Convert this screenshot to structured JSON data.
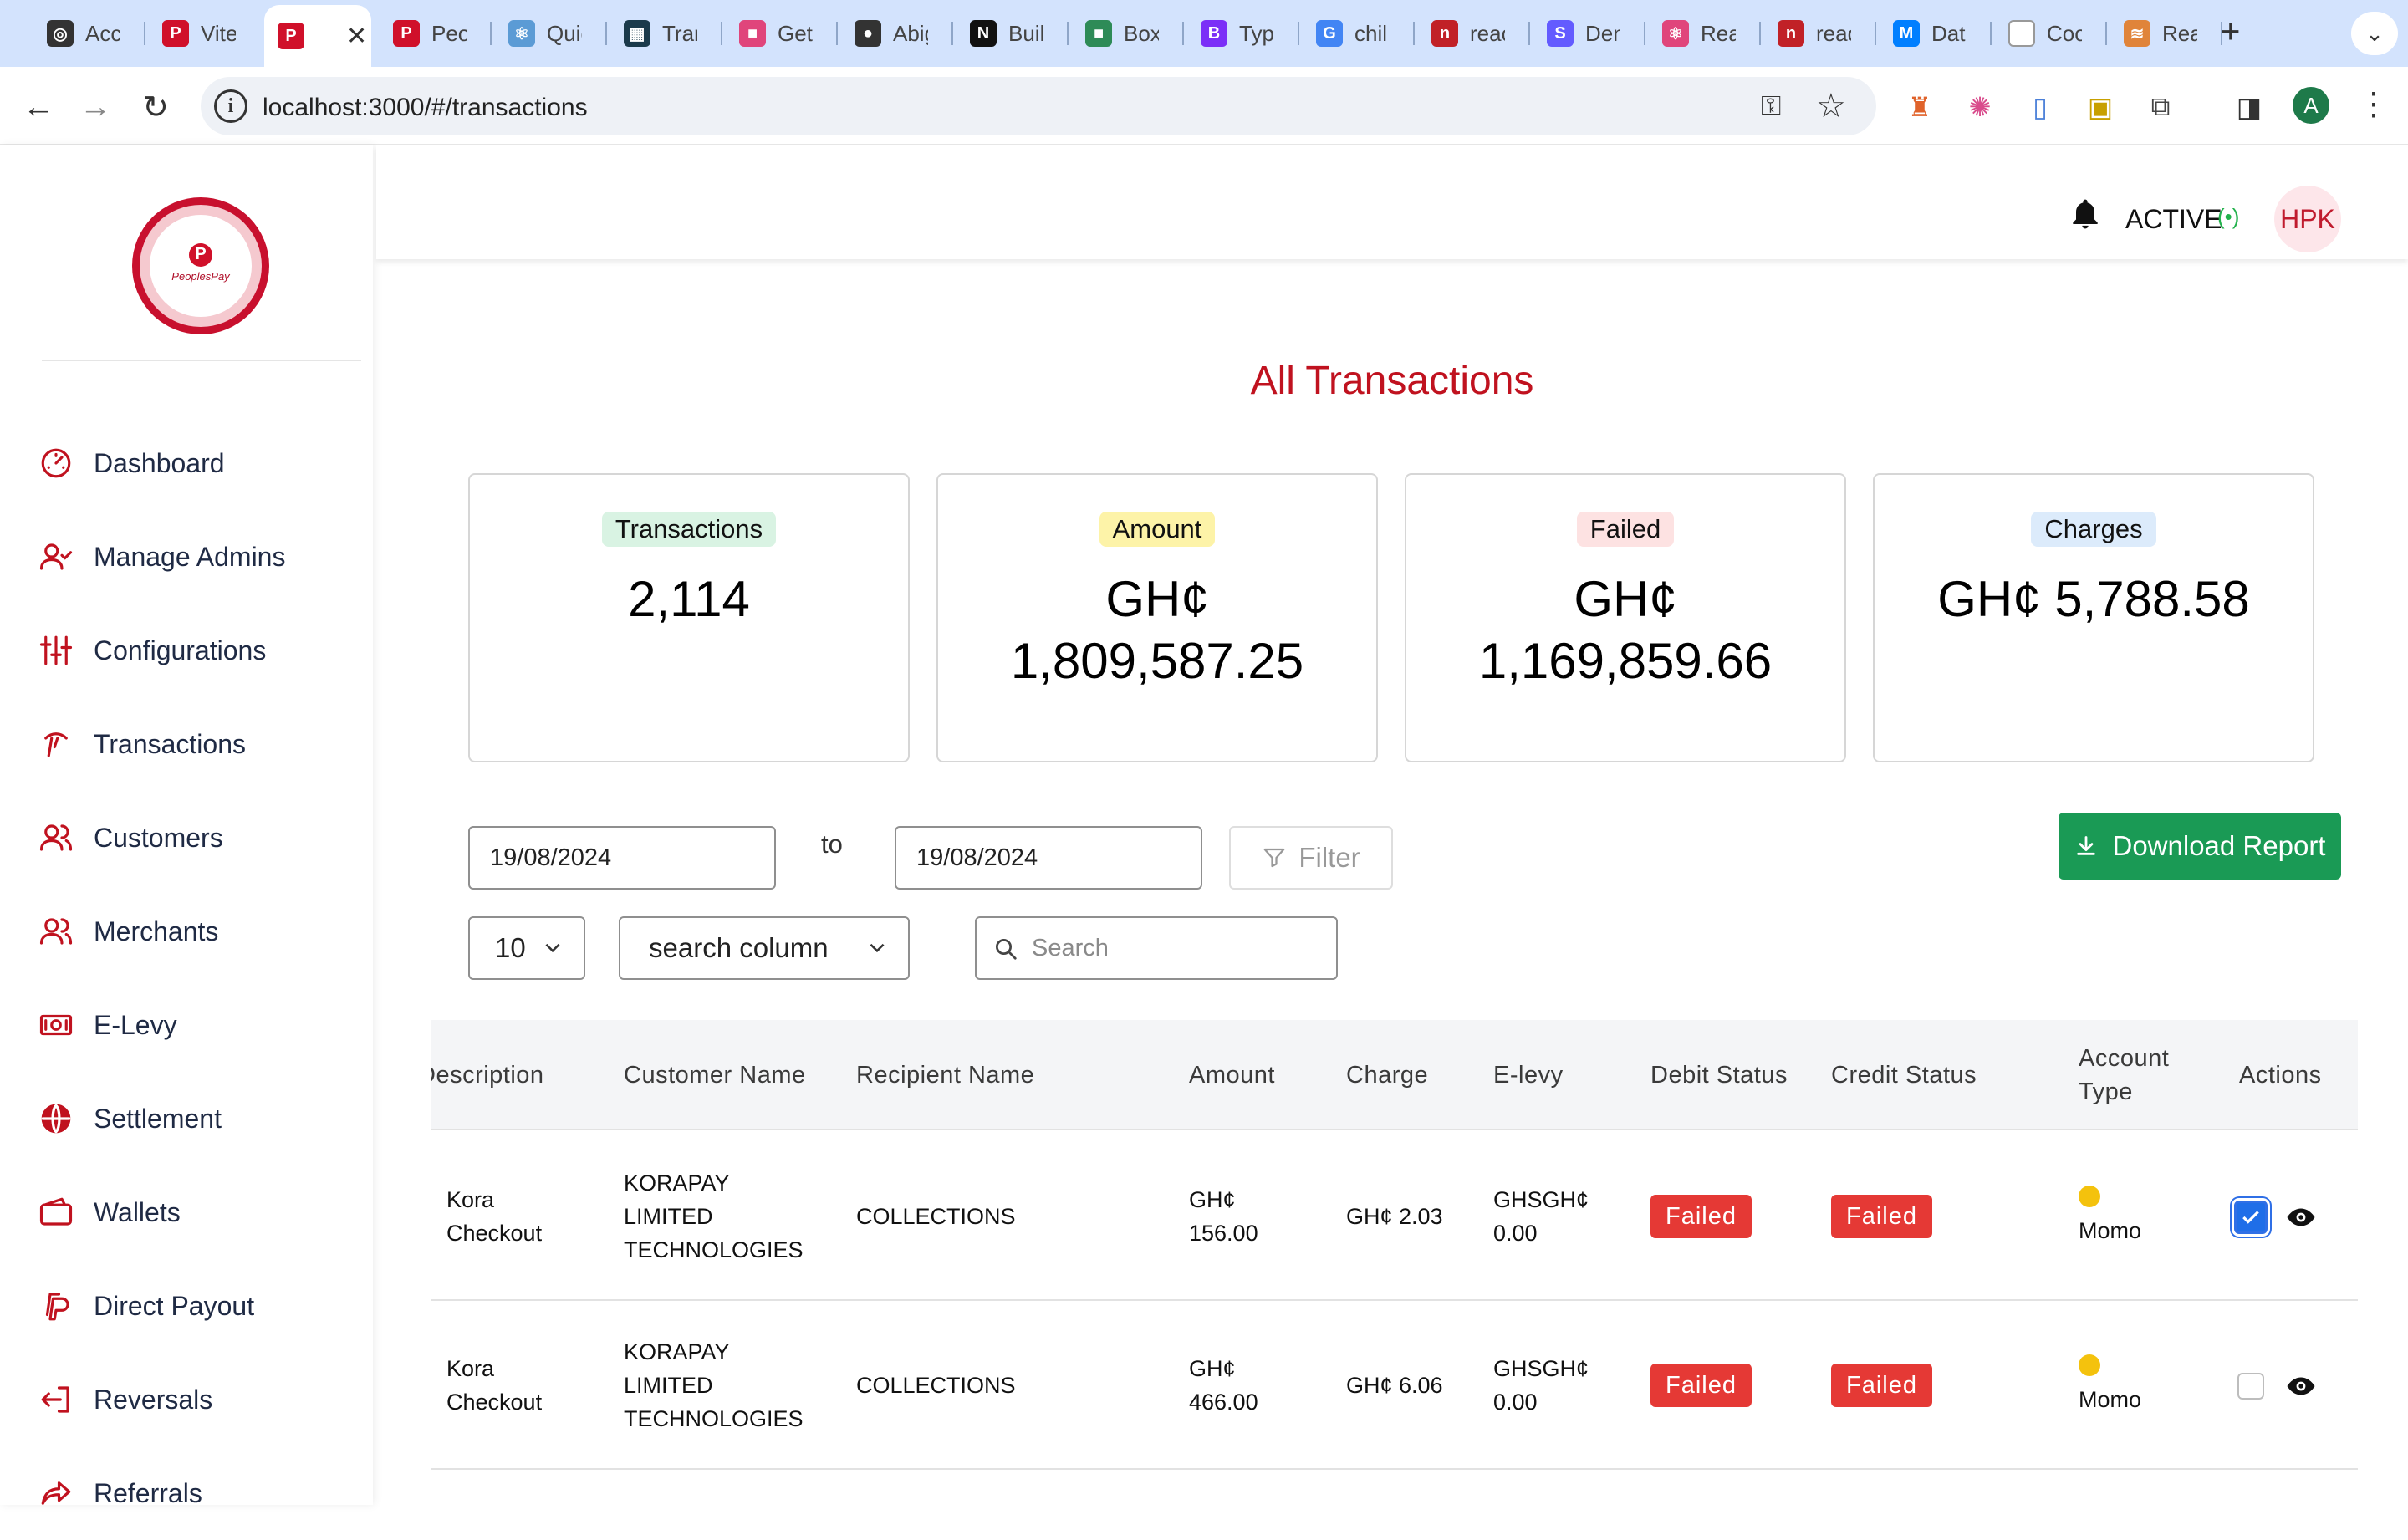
{
  "browser": {
    "tabs": [
      {
        "title": "Acc",
        "icon": "openai-icon",
        "color": "#333333",
        "glyph": "◎"
      },
      {
        "title": "Vite",
        "icon": "peoplespay-icon",
        "color": "#d0102a",
        "glyph": "P"
      },
      {
        "title": "",
        "icon": "peoplespay-icon",
        "color": "#d0102a",
        "glyph": "P",
        "active": true
      },
      {
        "title": "Peo",
        "icon": "peoplespay-icon",
        "color": "#d0102a",
        "glyph": "P"
      },
      {
        "title": "Quic",
        "icon": "react-icon",
        "color": "#5b9bd5",
        "glyph": "⚛"
      },
      {
        "title": "Tran",
        "icon": "code-icon",
        "color": "#1b3a4b",
        "glyph": "▦"
      },
      {
        "title": "Get",
        "icon": "app-icon",
        "color": "#e0457b",
        "glyph": "■"
      },
      {
        "title": "Abig",
        "icon": "github-icon",
        "color": "#333333",
        "glyph": "●"
      },
      {
        "title": "Buil",
        "icon": "nextjs-icon",
        "color": "#111111",
        "glyph": "N"
      },
      {
        "title": "Box",
        "icon": "box-icon",
        "color": "#2e8b57",
        "glyph": "■"
      },
      {
        "title": "Typ",
        "icon": "bootstrap-icon",
        "color": "#7b2ff7",
        "glyph": "B"
      },
      {
        "title": "chil",
        "icon": "google-icon",
        "color": "#4285f4",
        "glyph": "G"
      },
      {
        "title": "reac",
        "icon": "npm-icon",
        "color": "#c12127",
        "glyph": "n"
      },
      {
        "title": "Den",
        "icon": "stripe-icon",
        "color": "#635bff",
        "glyph": "S"
      },
      {
        "title": "Rea",
        "icon": "react-icon",
        "color": "#e0457b",
        "glyph": "⚛"
      },
      {
        "title": "reac",
        "icon": "npm-icon",
        "color": "#c12127",
        "glyph": "n"
      },
      {
        "title": "Dat",
        "icon": "mui-icon",
        "color": "#007fff",
        "glyph": "M"
      },
      {
        "title": "Coo",
        "icon": "blank-icon",
        "color": "#ffffff",
        "glyph": ""
      },
      {
        "title": "Rea",
        "icon": "flag-icon",
        "color": "#e0843a",
        "glyph": "≋"
      }
    ],
    "url": "localhost:3000/#/transactions",
    "profile_initial": "A"
  },
  "sidebar": {
    "logo_text": "PeoplesPay",
    "items": [
      {
        "label": "Dashboard",
        "icon": "gauge-icon"
      },
      {
        "label": "Manage Admins",
        "icon": "user-check-icon"
      },
      {
        "label": "Configurations",
        "icon": "sliders-icon"
      },
      {
        "label": "Transactions",
        "icon": "transfer-icon"
      },
      {
        "label": "Customers",
        "icon": "users-icon"
      },
      {
        "label": "Merchants",
        "icon": "users-icon"
      },
      {
        "label": "E-Levy",
        "icon": "cash-icon"
      },
      {
        "label": "Settlement",
        "icon": "globe-icon"
      },
      {
        "label": "Wallets",
        "icon": "wallet-icon"
      },
      {
        "label": "Direct Payout",
        "icon": "paypal-icon"
      },
      {
        "label": "Reversals",
        "icon": "reverse-icon"
      },
      {
        "label": "Referrals",
        "icon": "share-icon"
      }
    ]
  },
  "header": {
    "status": "ACTIVE",
    "avatar": "HPK"
  },
  "main": {
    "title": "All Transactions",
    "cards": [
      {
        "label": "Transactions",
        "value": "2,114",
        "badge_color": "#d9f3e3"
      },
      {
        "label": "Amount",
        "value": "GH¢ 1,809,587.25",
        "badge_color": "#fdf3a8"
      },
      {
        "label": "Failed",
        "value": "GH¢ 1,169,859.66",
        "badge_color": "#fde2e2"
      },
      {
        "label": "Charges",
        "value": "GH¢ 5,788.58",
        "badge_color": "#dcebfb"
      }
    ],
    "filters": {
      "from_date": "19/08/2024",
      "to_label": "to",
      "to_date": "19/08/2024",
      "filter_label": "Filter",
      "download_label": "Download Report",
      "page_size": "10",
      "column_select": "search column",
      "search_placeholder": "Search"
    }
  },
  "table": {
    "columns": [
      "Description",
      "Customer Name",
      "Recipient Name",
      "Amount",
      "Charge",
      "E-levy",
      "Debit Status",
      "Credit Status",
      "Account Type",
      "Actions"
    ],
    "rows": [
      {
        "description": "Kora Checkout",
        "customer": "KORAPAY LIMITED TECHNOLOGIES",
        "recipient": "COLLECTIONS",
        "amount": "GH¢ 156.00",
        "charge": "GH¢ 2.03",
        "elevy": "GHSGH¢ 0.00",
        "debit_status": "Failed",
        "credit_status": "Failed",
        "account_type": "Momo",
        "checked": true
      },
      {
        "description": "Kora Checkout",
        "customer": "KORAPAY LIMITED TECHNOLOGIES",
        "recipient": "COLLECTIONS",
        "amount": "GH¢ 466.00",
        "charge": "GH¢ 6.06",
        "elevy": "GHSGH¢ 0.00",
        "debit_status": "Failed",
        "credit_status": "Failed",
        "account_type": "Momo",
        "checked": false
      }
    ]
  }
}
